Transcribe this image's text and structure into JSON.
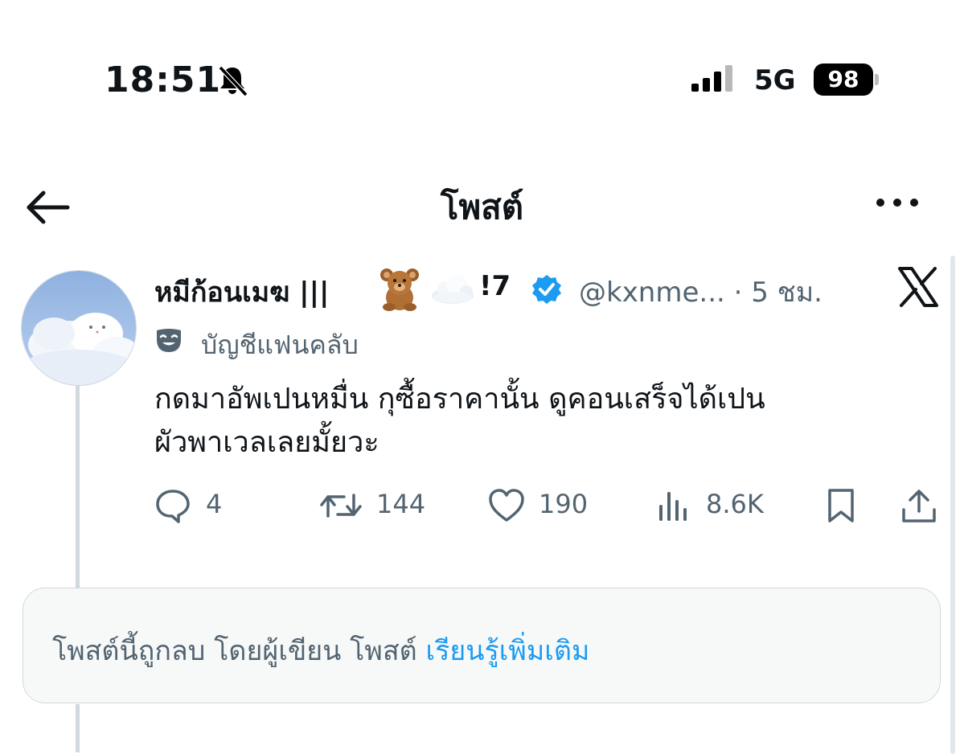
{
  "status_bar": {
    "time": "18:51",
    "network": "5G",
    "battery": "98",
    "icons": [
      "bell-slash-icon",
      "signal-bars-icon",
      "battery-icon"
    ]
  },
  "nav": {
    "title": "โพสต์",
    "back_icon": "arrow-left-icon",
    "more_icon": "more-horizontal-icon"
  },
  "post": {
    "display_name": "หมีก้อนเมฆ |||",
    "name_emojis": [
      "teddy-bear-emoji",
      "cloud-emoji"
    ],
    "name_suffix": "!7",
    "verified": true,
    "handle_meta": "@kxnme... · 5 ชม.",
    "source_icon": "x-logo-icon",
    "account_label": "บัญชีแฟนคลับ",
    "account_label_icon": "theater-mask-icon",
    "text": "กดมาอัพเปนหมื่น กุซื้อราคานั้น ดูคอนเสร็จได้เปน\nผัวพาเวลเลยมั้ยวะ",
    "stats": {
      "replies": "4",
      "reposts": "144",
      "likes": "190",
      "views": "8.6K"
    }
  },
  "notice": {
    "text": "โพสต์นี้ถูกลบ โดยผู้เขียน โพสต์",
    "link": "เรียนรู้เพิ่มเติม"
  },
  "colors": {
    "accent": "#1d9bf0",
    "secondary_text": "#536471",
    "notice_bg": "#f7f9f9"
  }
}
